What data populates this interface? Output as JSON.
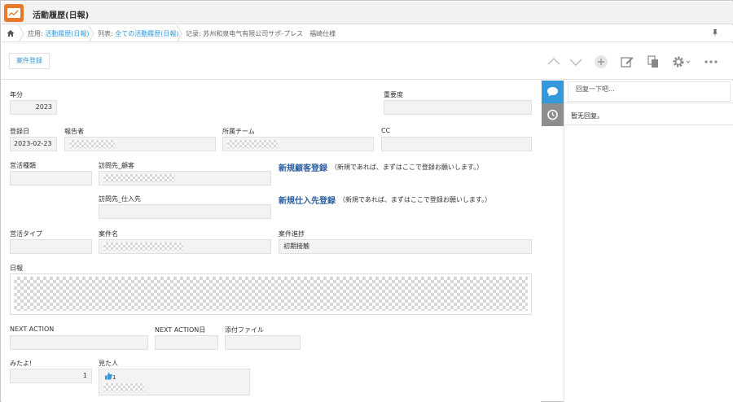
{
  "window": {
    "title": "活動履歴(日報)"
  },
  "breadcrumb": {
    "app_prefix": "应用: ",
    "app_link": "活動履歴(日報)",
    "list_prefix": "列表: ",
    "list_link": "全ての活動履歴(日報)",
    "record": "记录: 苏州和泉电气有限公司サポ-プレス　福崎仕様"
  },
  "toolbar": {
    "case_register_label": "案件登録",
    "icons": [
      "chevron-up-icon",
      "chevron-down-icon",
      "plus-icon",
      "edit-icon",
      "copy-icon",
      "gear-icon",
      "more-icon"
    ]
  },
  "form": {
    "year": {
      "label": "年分",
      "value": "2023"
    },
    "importance": {
      "label": "重要度",
      "value": ""
    },
    "reg_date": {
      "label": "登録日",
      "value": "2023-02-23"
    },
    "reporter": {
      "label": "報告者"
    },
    "team": {
      "label": "所属チーム"
    },
    "cc": {
      "label": "CC",
      "value": ""
    },
    "sales_type": {
      "label": "営活種類",
      "value": ""
    },
    "visit_customer": {
      "label": "訪問先_顧客"
    },
    "new_customer": {
      "link": "新規顧客登録",
      "note": "（新規であれば、まずはここで登録お願いします。）"
    },
    "visit_supplier": {
      "label": "訪問先_仕入先",
      "value": ""
    },
    "new_supplier": {
      "link": "新規仕入先登録",
      "note": "（新規であれば、まずはここで登録お願いします。）"
    },
    "activity_type": {
      "label": "営活タイプ",
      "value": ""
    },
    "case_name": {
      "label": "案件名"
    },
    "case_progress": {
      "label": "案件進捗",
      "value": "初期接触"
    },
    "daily_report": {
      "label": "日報"
    },
    "next_action": {
      "label": "NEXT ACTION",
      "value": ""
    },
    "next_action_date": {
      "label": "NEXT ACTION日",
      "value": ""
    },
    "attachment": {
      "label": "添付ファイル",
      "value": ""
    },
    "mitayo": {
      "label": "みたよ!",
      "value": "1"
    },
    "viewers": {
      "label": "見た人",
      "like_count": "1"
    }
  },
  "comments": {
    "input_placeholder": "回复一下吧...",
    "empty_text": "暂无回复。"
  },
  "colors": {
    "accent": "#3498db",
    "app_icon": "#e9782a",
    "link_dark": "#2c5f9e"
  }
}
